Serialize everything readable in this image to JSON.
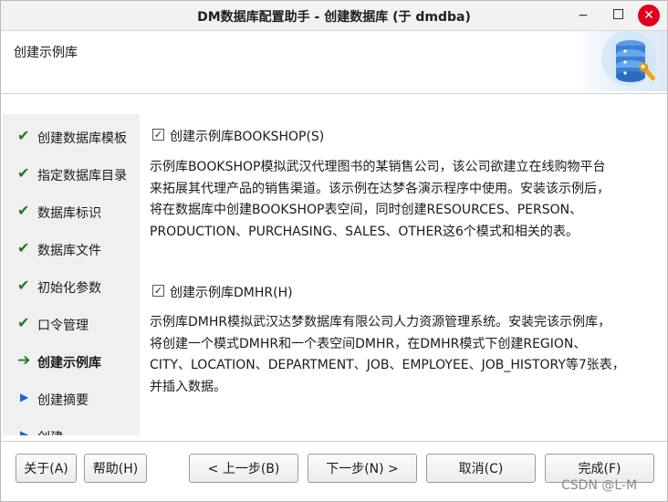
{
  "window": {
    "title": "DM数据库配置助手 - 创建数据库 (于 dmdba)",
    "min_glyph": "−",
    "close_glyph": "✕"
  },
  "banner": {
    "title": "创建示例库",
    "art_icon": "database-wrench-icon"
  },
  "nav": {
    "items": [
      {
        "label": "创建数据库模板",
        "state": "done",
        "glyph": "✔"
      },
      {
        "label": "指定数据库目录",
        "state": "done",
        "glyph": "✔"
      },
      {
        "label": "数据库标识",
        "state": "done",
        "glyph": "✔"
      },
      {
        "label": "数据库文件",
        "state": "done",
        "glyph": "✔"
      },
      {
        "label": "初始化参数",
        "state": "done",
        "glyph": "✔"
      },
      {
        "label": "口令管理",
        "state": "done",
        "glyph": "✔"
      },
      {
        "label": "创建示例库",
        "state": "current",
        "glyph": "➔"
      },
      {
        "label": "创建摘要",
        "state": "pending",
        "glyph": "▶"
      },
      {
        "label": "创建",
        "state": "pending",
        "glyph": "▶"
      }
    ]
  },
  "bookshop": {
    "checked": true,
    "check_glyph": "✓",
    "label": "创建示例库BOOKSHOP(S)",
    "description": [
      "示例库BOOKSHOP模拟武汉代理图书的某销售公司，该公司欲建立在线购物平台",
      "来拓展其代理产品的销售渠道。该示例在达梦各演示程序中使用。安装该示例后，",
      "将在数据库中创建BOOKSHOP表空间，同时创建RESOURCES、PERSON、",
      "PRODUCTION、PURCHASING、SALES、OTHER这6个模式和相关的表。"
    ]
  },
  "dmhr": {
    "checked": true,
    "check_glyph": "✓",
    "label": "创建示例库DMHR(H)",
    "description": [
      "示例库DMHR模拟武汉达梦数据库有限公司人力资源管理系统。安装完该示例库，",
      "将创建一个模式DMHR和一个表空间DMHR，在DMHR模式下创建REGION、",
      "CITY、LOCATION、DEPARTMENT、JOB、EMPLOYEE、JOB_HISTORY等7张表，",
      "并插入数据。"
    ]
  },
  "buttons": {
    "about": "关于(A)",
    "help": "帮助(H)",
    "prev": "< 上一步(B)",
    "next": "下一步(N) >",
    "cancel": "取消(C)",
    "finish": "完成(F)"
  },
  "watermark": "CSDN @L-M",
  "colors": {
    "check_green": "#1f7a1f",
    "pending_blue": "#1e66d0",
    "close_red": "#e0001b",
    "nav_bg": "#f0f0f0"
  }
}
